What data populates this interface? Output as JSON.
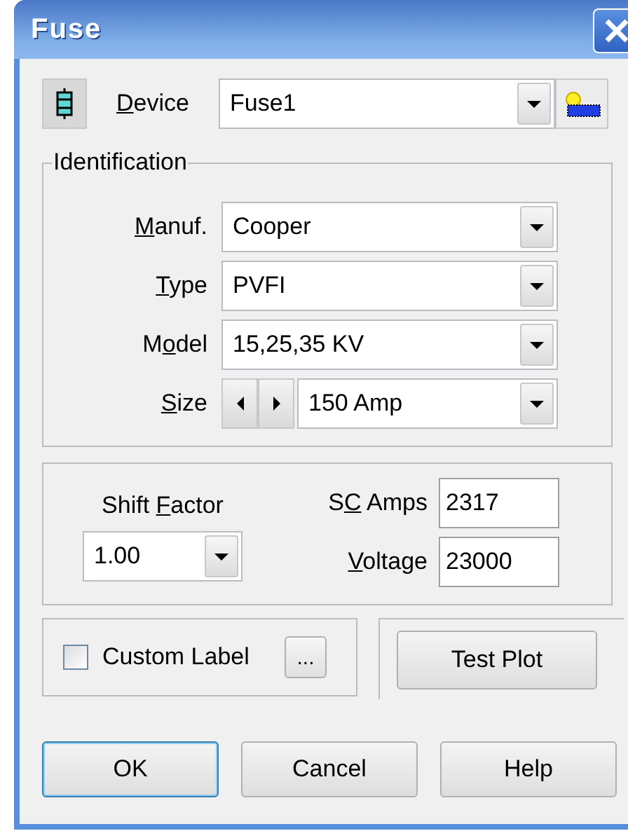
{
  "window": {
    "title": "Fuse"
  },
  "device": {
    "label": {
      "key": "D",
      "post": "evice"
    },
    "value": "Fuse1"
  },
  "identification": {
    "title": "Identification",
    "fields": [
      {
        "kind": "combo",
        "label": {
          "key": "M",
          "post": "anuf."
        },
        "value": "Cooper"
      },
      {
        "kind": "combo",
        "label": {
          "key": "T",
          "post": "ype"
        },
        "value": "PVFI"
      },
      {
        "kind": "combo",
        "label": {
          "pre": "M",
          "key": "o",
          "post": "del"
        },
        "value": "15,25,35 KV"
      },
      {
        "kind": "spin-combo",
        "label": {
          "key": "S",
          "post": "ize"
        },
        "value": "150 Amp"
      }
    ]
  },
  "settings": {
    "shift_factor": {
      "label": {
        "pre": "Shift ",
        "key": "F",
        "post": "actor"
      },
      "value": "1.00"
    },
    "sc_amps": {
      "label": {
        "pre": "S",
        "key": "C",
        "post": " Amps"
      },
      "value": "2317"
    },
    "voltage": {
      "label": {
        "key": "V",
        "post": "oltage"
      },
      "value": "23000"
    }
  },
  "custom_label": {
    "label": "Custom Label",
    "checked": false,
    "button": "..."
  },
  "test_plot": "Test Plot",
  "buttons": [
    {
      "label": "OK",
      "default": true
    },
    {
      "label": "Cancel",
      "default": false
    },
    {
      "label": "Help",
      "default": false
    }
  ]
}
